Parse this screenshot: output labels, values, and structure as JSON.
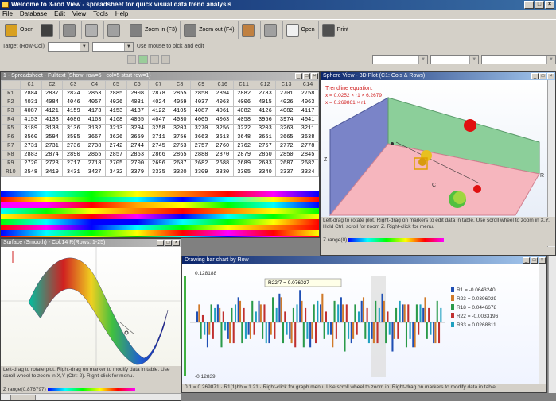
{
  "app": {
    "title": "Welcome to 3-rod View - spreadsheet for quick visual data trend analysis"
  },
  "menu": [
    "File",
    "Database",
    "Edit",
    "View",
    "Tools",
    "Help"
  ],
  "toolbar": [
    {
      "label": "Open",
      "icon": "folder-icon",
      "color": "#d8a020"
    },
    {
      "label": "",
      "icon": "binoculars-icon",
      "color": "#404040"
    },
    {
      "label": "",
      "icon": "print-icon",
      "color": "#909090"
    },
    {
      "label": "",
      "icon": "globe-icon",
      "color": "#b0b0b0"
    },
    {
      "label": "",
      "icon": "chart-icon",
      "color": "#a0a0a0"
    },
    {
      "label": "Zoom in (F3)",
      "icon": "zoom-in-icon",
      "color": "#808080"
    },
    {
      "label": "Zoom out (F4)",
      "icon": "zoom-out-icon",
      "color": "#808080"
    },
    {
      "label": "",
      "icon": "surface-icon",
      "color": "#c08040"
    },
    {
      "label": "",
      "icon": "car-icon",
      "color": "#a0a0a0"
    },
    {
      "label": "Open",
      "icon": "document-icon",
      "color": "#f0f0f0"
    },
    {
      "label": "Print",
      "icon": "printer-icon",
      "color": "#505050"
    }
  ],
  "options": {
    "target_label": "Target (Row-Col)",
    "hint": "Use mouse to pick and edit"
  },
  "spreadsheet": {
    "title": "1 - Spreadsheet - Fulltext (Show: row=5+ col=5 start row=1)",
    "columns": [
      "C1",
      "C2",
      "C3",
      "C4",
      "C5",
      "C6",
      "C7",
      "C8",
      "C9",
      "C10",
      "C11",
      "C12",
      "C13",
      "C14"
    ],
    "rows": [
      {
        "h": "R1",
        "v": [
          "2884",
          "2837",
          "2824",
          "2853",
          "2885",
          "2908",
          "2878",
          "2855",
          "2858",
          "2894",
          "2882",
          "2783",
          "2701",
          "2758"
        ]
      },
      {
        "h": "R2",
        "v": [
          "4031",
          "4084",
          "4046",
          "4057",
          "4026",
          "4031",
          "4024",
          "4059",
          "4037",
          "4063",
          "4006",
          "4015",
          "4026",
          "4063"
        ]
      },
      {
        "h": "R3",
        "v": [
          "4087",
          "4121",
          "4159",
          "4173",
          "4153",
          "4137",
          "4122",
          "4105",
          "4087",
          "4061",
          "4082",
          "4126",
          "4082",
          "4117"
        ]
      },
      {
        "h": "R4",
        "v": [
          "4153",
          "4133",
          "4086",
          "4163",
          "4168",
          "4055",
          "4047",
          "4030",
          "4005",
          "4063",
          "4058",
          "3956",
          "3974",
          "4041"
        ]
      },
      {
        "h": "R5",
        "v": [
          "3189",
          "3138",
          "3136",
          "3132",
          "3213",
          "3294",
          "3258",
          "3203",
          "3270",
          "3256",
          "3222",
          "3203",
          "3263",
          "3211"
        ]
      },
      {
        "h": "R6",
        "v": [
          "3560",
          "3594",
          "3595",
          "3667",
          "3626",
          "3659",
          "3711",
          "3756",
          "3663",
          "3613",
          "3648",
          "3661",
          "3665",
          "3638"
        ]
      },
      {
        "h": "R7",
        "v": [
          "2731",
          "2731",
          "2736",
          "2738",
          "2742",
          "2744",
          "2745",
          "2753",
          "2757",
          "2760",
          "2762",
          "2767",
          "2772",
          "2778"
        ]
      },
      {
        "h": "R8",
        "v": [
          "2883",
          "2874",
          "2890",
          "2865",
          "2857",
          "2853",
          "2866",
          "2865",
          "2888",
          "2870",
          "2879",
          "2860",
          "2850",
          "2845"
        ]
      },
      {
        "h": "R9",
        "v": [
          "2720",
          "2723",
          "2717",
          "2718",
          "2705",
          "2700",
          "2696",
          "2687",
          "2682",
          "2688",
          "2689",
          "2683",
          "2687",
          "2682"
        ]
      },
      {
        "h": "R10",
        "v": [
          "2548",
          "3419",
          "3431",
          "3427",
          "3432",
          "3379",
          "3335",
          "3320",
          "3309",
          "3330",
          "3305",
          "3340",
          "3337",
          "3324"
        ]
      }
    ]
  },
  "scatter3d": {
    "title": "Sphere View - 3D Plot (C1: Cols & Rows)",
    "regression_label": "Trendline equation:",
    "eq1": "x = 0.0252 × r1 × 6.2679",
    "eq2": "x = 0.269861 × r1",
    "status": "Left-drag to rotate plot. Right-drag on markers to edit data in table. Use scroll wheel to zoom in X,Y. Hold Ctrl, scroll for zoom Z. Right-click for menu.",
    "range_label": "Z range(0)",
    "axis_x": "R",
    "axis_y": "C",
    "axis_z": "Z"
  },
  "surface": {
    "title": "Surface (Smooth) - Col:14 R(Rows: 1-25)",
    "status": "Left-drag to rotate plot. Right-drag on marker to modify data in table. Use scroll wheel to zoom in X,Y (Ctrl: 2). Right-click for menu.",
    "range_label": "Z range(0.876797)"
  },
  "barchart": {
    "title": "Drawing bar chart by Row",
    "ymax_label": "0.128188",
    "ymin_label": "-0.12839",
    "tooltip": "R22/7 = 0.076027",
    "status": "0.1 = 0.269871 · R1(1)bb = 1.21 · Right-click for graph menu. Use scroll wheel to zoom in. Right-drag on markers to modify data in table.",
    "legend": [
      {
        "label": "R1 = -0.0643240",
        "color": "#1f4fb4"
      },
      {
        "label": "R23 = 0.0396029",
        "color": "#d07a2a"
      },
      {
        "label": "R18 = 0.0446678",
        "color": "#2a9a4a"
      },
      {
        "label": "R22 = -0.0033196",
        "color": "#c03030"
      },
      {
        "label": "R33 = 0.0268811",
        "color": "#20a0c0"
      }
    ]
  },
  "chart_data": {
    "type": "bar",
    "title": "Drawing bar chart by Row",
    "ylim": [
      -0.12839,
      0.128188
    ],
    "series": [
      {
        "name": "R1 = -0.0643240",
        "values": [
          0.03,
          -0.06,
          0.05,
          -0.04,
          0.07,
          -0.03,
          0.06,
          -0.05,
          0.08,
          -0.04,
          0.09,
          -0.06,
          0.05,
          -0.03,
          0.07,
          -0.05,
          0.06,
          -0.04,
          0.08,
          -0.07,
          0.05,
          -0.06,
          0.04,
          -0.05
        ]
      },
      {
        "name": "R23 = 0.0396029",
        "values": [
          0.05,
          -0.03,
          0.04,
          -0.05,
          0.06,
          -0.04,
          0.05,
          -0.03,
          0.07,
          -0.05,
          0.06,
          -0.04,
          0.08,
          -0.06,
          0.05,
          -0.04,
          0.07,
          -0.05,
          0.06,
          -0.04,
          0.05,
          -0.06,
          0.07,
          -0.05
        ]
      },
      {
        "name": "R18 = 0.0446678",
        "values": [
          -0.04,
          0.05,
          -0.06,
          0.04,
          -0.05,
          0.06,
          -0.04,
          0.07,
          -0.05,
          0.04,
          -0.06,
          0.05,
          -0.04,
          0.06,
          -0.07,
          0.05,
          -0.04,
          0.06,
          -0.05,
          0.04,
          -0.06,
          0.05,
          -0.04,
          0.06
        ]
      },
      {
        "name": "R22 = -0.0033196",
        "values": [
          0.02,
          -0.04,
          0.03,
          -0.05,
          0.04,
          -0.03,
          0.05,
          -0.04,
          0.03,
          -0.06,
          0.04,
          -0.05,
          0.03,
          -0.04,
          0.05,
          -0.03,
          0.04,
          -0.05,
          0.03,
          -0.04,
          0.05,
          -0.03,
          0.04,
          -0.05
        ]
      },
      {
        "name": "R33 = 0.0268811",
        "values": [
          -0.03,
          0.04,
          -0.02,
          0.05,
          -0.04,
          0.03,
          -0.05,
          0.04,
          -0.03,
          0.05,
          -0.04,
          0.06,
          -0.03,
          0.05,
          -0.04,
          0.03,
          -0.05,
          0.04,
          -0.03,
          0.06,
          -0.04,
          0.05,
          -0.03,
          0.04
        ]
      }
    ]
  }
}
